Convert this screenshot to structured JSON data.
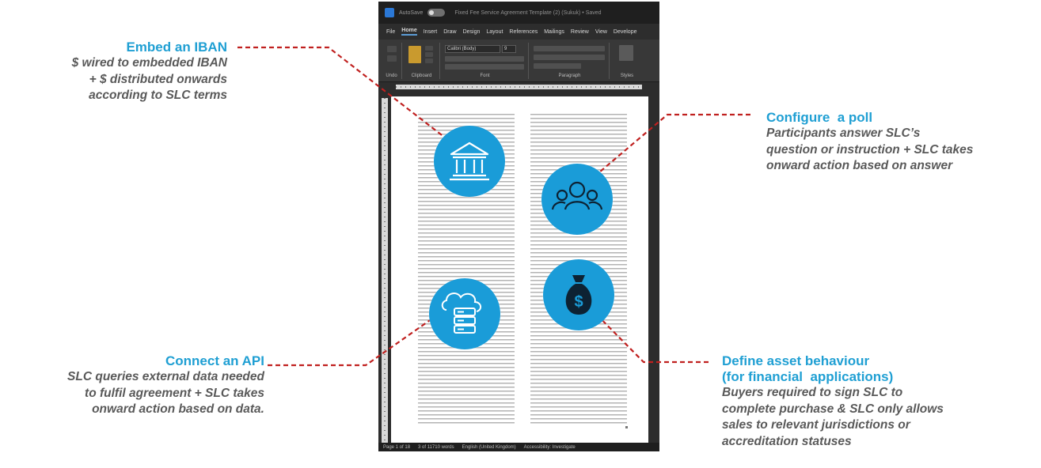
{
  "callouts": {
    "iban": {
      "title": "Embed an IBAN",
      "desc": "$ wired to embedded IBAN\n+ $ distributed onwards\naccording to SLC terms"
    },
    "api": {
      "title": "Connect an API",
      "desc": "SLC queries external data needed\nto fulfil agreement + SLC takes\nonward action based on data."
    },
    "poll": {
      "title": "Configure  a poll",
      "desc": "Participants answer SLC’s\nquestion or instruction + SLC takes\nonward action based on answer"
    },
    "asset": {
      "title": "Define asset behaviour\n(for financial  applications)",
      "desc": "Buyers required to sign SLC to\ncomplete purchase & SLC only allows\nsales to relevant jurisdictions or\naccreditation statuses"
    }
  },
  "word": {
    "autosave": "AutoSave",
    "doc_title": "Fixed Fee Service Agreement Template (2) (Sukuk)  •  Saved",
    "tabs": [
      "File",
      "Home",
      "Insert",
      "Draw",
      "Design",
      "Layout",
      "References",
      "Mailings",
      "Review",
      "View",
      "Develope"
    ],
    "active_tab": "Home",
    "font_name": "Calibri (Body)",
    "font_size": "9",
    "ribbon_groups": [
      "Undo",
      "Clipboard",
      "Font",
      "Paragraph",
      "Styles"
    ],
    "status": {
      "page": "Page 1 of 18",
      "words": "3 of 11710 words",
      "language": "English (United Kingdom)",
      "accessibility": "Accessibility: Investigate"
    }
  },
  "icons": {
    "bank": "bank-icon",
    "people": "people-group-icon",
    "cloud": "cloud-server-icon",
    "money": "money-bag-icon"
  },
  "colors": {
    "accent_blue": "#1a9cd8",
    "title_blue": "#1f9fd3",
    "connector_red": "#c0201f",
    "desc_gray": "#595959"
  }
}
